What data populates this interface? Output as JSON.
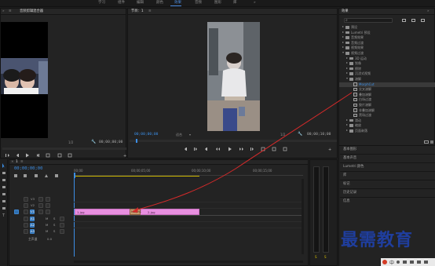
{
  "workspace_tabs": [
    "学习",
    "组件",
    "编辑",
    "颜色",
    "效果",
    "音频",
    "图形",
    "库"
  ],
  "workspace_active": "效果",
  "source_panel": {
    "tab": "音频剪辑混合器",
    "timecode_right": "00;00;00;00",
    "zoom": "1/2"
  },
  "program_panel": {
    "tab": "节目：1",
    "timecode_left": "00;00;00;00",
    "fit": "适合",
    "zoom": "1/2",
    "timecode_right": "00;00;10;00"
  },
  "effects_panel": {
    "tab": "效果",
    "search_placeholder": "",
    "items": [
      {
        "label": "预设",
        "type": "folder"
      },
      {
        "label": "Lumetri 预设",
        "type": "folder"
      },
      {
        "label": "音频效果",
        "type": "folder"
      },
      {
        "label": "音频过渡",
        "type": "folder"
      },
      {
        "label": "视频效果",
        "type": "folder"
      },
      {
        "label": "视频过渡",
        "type": "folder",
        "open": true
      },
      {
        "label": "3D 运动",
        "type": "folder"
      },
      {
        "label": "划像",
        "type": "folder"
      },
      {
        "label": "擦除",
        "type": "folder"
      },
      {
        "label": "沉浸式视频",
        "type": "folder"
      },
      {
        "label": "溶解",
        "type": "folder",
        "open": true
      },
      {
        "label": "MorphCut",
        "type": "effect",
        "selected": true
      },
      {
        "label": "交叉溶解",
        "type": "effect"
      },
      {
        "label": "叠加溶解",
        "type": "effect"
      },
      {
        "label": "白场过渡",
        "type": "effect"
      },
      {
        "label": "胶片溶解",
        "type": "effect"
      },
      {
        "label": "非叠加溶解",
        "type": "effect"
      },
      {
        "label": "黑场过渡",
        "type": "effect"
      },
      {
        "label": "滑动",
        "type": "folder"
      },
      {
        "label": "缩放",
        "type": "folder"
      },
      {
        "label": "页面剥落",
        "type": "folder"
      }
    ]
  },
  "side_panels": [
    "基本图形",
    "基本声音",
    "Lumetri 颜色",
    "库",
    "标记",
    "历史记录",
    "信息"
  ],
  "timeline": {
    "tab": "1",
    "timecode": "00;00;00;00",
    "ruler_labels": [
      "00;00",
      "00;00;05;00",
      "00;00;10;00",
      "00;00;15;00"
    ],
    "tracks": [
      {
        "name": "V3",
        "type": "video"
      },
      {
        "name": "V2",
        "type": "video"
      },
      {
        "name": "V1",
        "type": "video",
        "active": true
      },
      {
        "name": "A1",
        "type": "audio"
      },
      {
        "name": "A2",
        "type": "audio"
      },
      {
        "name": "A3",
        "type": "audio"
      }
    ],
    "master_label": "主声道",
    "master_value": "0.0",
    "clips": [
      {
        "label": "1.jpg"
      },
      {
        "label": "2.jpg"
      }
    ],
    "transition_label": "MorphC"
  },
  "meter": {
    "labels": [
      "S",
      "S"
    ]
  },
  "watermark": "最需教育",
  "colors": {
    "accent": "#3c8ee5",
    "clip": "#e88fe0",
    "arrow": "#d42a2a",
    "watermark": "#1f3e9e"
  }
}
